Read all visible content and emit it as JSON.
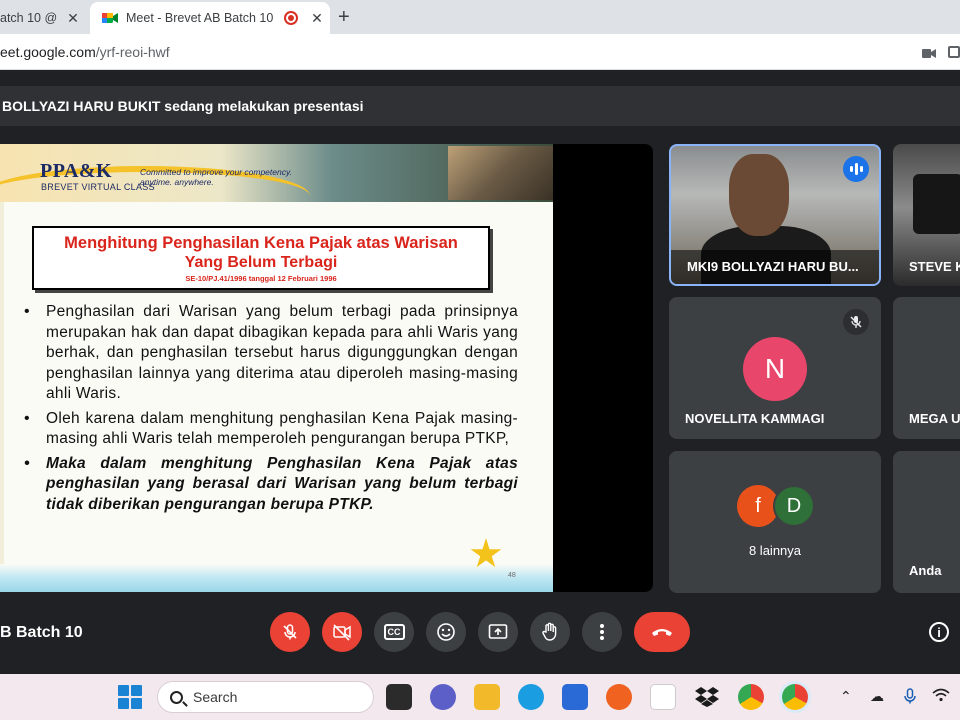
{
  "browser": {
    "tabs": [
      {
        "title": "atch 10 @",
        "close": "✕",
        "active": false
      },
      {
        "title": "Meet - Brevet AB Batch 10",
        "close": "✕",
        "active": true
      }
    ],
    "new_tab": "+",
    "url_host": "eet.google.com",
    "url_path": "/yrf-reoi-hwf"
  },
  "meet": {
    "presenting_banner": "BOLLYAZI HARU BUKIT sedang melakukan presentasi",
    "meeting_name": "B Batch 10",
    "slide": {
      "logo": "PPA&K",
      "logo_sub": "BREVET VIRTUAL CLASS",
      "tagline_1": "Committed to improve your competency.",
      "tagline_2": "anytime. anywhere.",
      "title_1": "Menghitung Penghasilan Kena Pajak atas Warisan",
      "title_2": "Yang Belum Terbagi",
      "title_ref": "SE-10/PJ.41/1996 tanggal 12 Februari 1996",
      "bullets": [
        "Penghasilan dari Warisan yang belum terbagi pada prinsipnya merupakan hak dan dapat dibagikan kepada para ahli Waris yang berhak, dan penghasilan tersebut harus digunggungkan dengan penghasilan lainnya yang diterima atau diperoleh masing-masing ahli Waris.",
        "Oleh karena dalam menghitung penghasilan Kena Pajak masing-masing ahli Waris telah memperoleh pengurangan berupa PTKP,",
        "Maka dalam menghitung Penghasilan Kena Pajak atas penghasilan yang berasal dari Warisan yang belum terbagi tidak diberikan pengurangan berupa PTKP."
      ],
      "page_number": "48"
    },
    "participants": [
      {
        "name": "MKI9 BOLLYAZI HARU BU...",
        "speaking": true
      },
      {
        "name": "STEVE K"
      },
      {
        "name": "NOVELLITA KAMMAGI",
        "initial": "N",
        "color": "#e8466b",
        "muted": true
      },
      {
        "name": "MEGA U"
      },
      {
        "name": "8 lainnya",
        "initials": [
          "f",
          "D"
        ]
      },
      {
        "name": "Anda"
      }
    ],
    "controls": {
      "mic": "mic-off-icon",
      "camera": "camera-off-icon",
      "captions_label": "CC",
      "emoji": "emoji-icon",
      "present": "present-icon",
      "hand": "raise-hand-icon",
      "more": "more-options-icon",
      "leave": "end-call-icon",
      "info": "i"
    },
    "colors": {
      "leave": "#ea4335",
      "accent": "#8ab4f8",
      "speaking_badge": "#1a73e8"
    }
  },
  "taskbar": {
    "search_placeholder": "Search"
  }
}
